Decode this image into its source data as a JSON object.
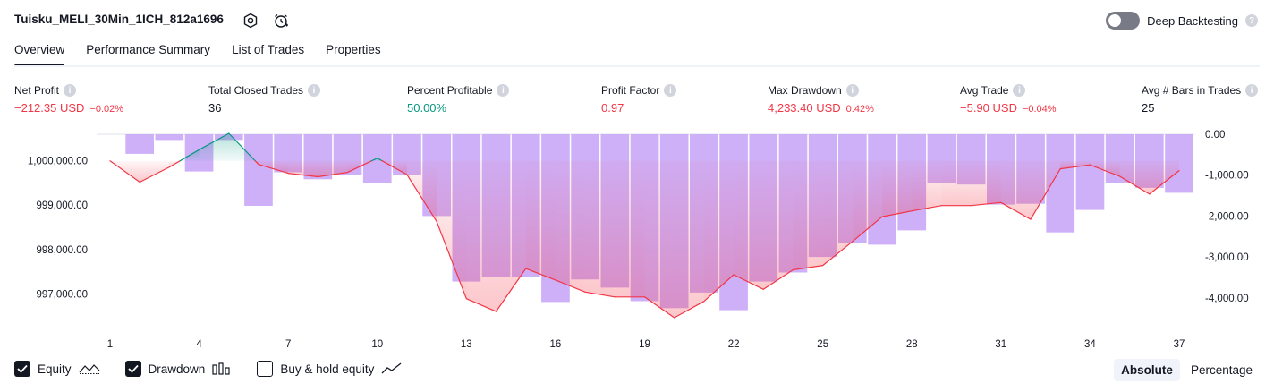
{
  "header": {
    "strategy_title": "Tuisku_MELI_30Min_1ICH_812a1696",
    "settings_icon": "settings-icon",
    "alert_icon": "alarm-clock-icon",
    "deep_backtesting_label": "Deep Backtesting",
    "deep_backtesting_on": false
  },
  "tabs": [
    {
      "label": "Overview",
      "active": true
    },
    {
      "label": "Performance Summary",
      "active": false
    },
    {
      "label": "List of Trades",
      "active": false
    },
    {
      "label": "Properties",
      "active": false
    }
  ],
  "metrics": {
    "net_profit": {
      "label": "Net Profit",
      "value": "−212.35 USD",
      "pct": "−0.02%"
    },
    "total_closed_trades": {
      "label": "Total Closed Trades",
      "value": "36"
    },
    "percent_profitable": {
      "label": "Percent Profitable",
      "value": "50.00%"
    },
    "profit_factor": {
      "label": "Profit Factor",
      "value": "0.97"
    },
    "max_drawdown": {
      "label": "Max Drawdown",
      "value": "4,233.40 USD",
      "pct": "0.42%"
    },
    "avg_trade": {
      "label": "Avg Trade",
      "value": "−5.90 USD",
      "pct": "−0.04%"
    },
    "avg_bars": {
      "label": "Avg # Bars in Trades",
      "value": "25"
    }
  },
  "legend": {
    "equity_label": "Equity",
    "equity_checked": true,
    "drawdown_label": "Drawdown",
    "drawdown_checked": true,
    "buyhold_label": "Buy & hold equity",
    "buyhold_checked": false
  },
  "view_toggle": {
    "absolute_label": "Absolute",
    "percentage_label": "Percentage",
    "active": "Absolute"
  },
  "colors": {
    "accent": "#131722",
    "negative": "#f23645",
    "positive": "#089981",
    "drawdown_bar": "#c9a7f7",
    "equity_line": "#f23645"
  },
  "chart_data": {
    "type": "line",
    "x_ticks": [
      "1",
      "4",
      "7",
      "10",
      "13",
      "16",
      "19",
      "22",
      "25",
      "28",
      "31",
      "34",
      "37"
    ],
    "left_axis": {
      "ticks": [
        "1,000,000.00",
        "999,000.00",
        "998,000.00",
        "997,000.00"
      ],
      "tick_values": [
        1000000,
        999000,
        998000,
        997000
      ],
      "ylim": [
        996400,
        1000600
      ]
    },
    "right_axis": {
      "ticks": [
        "0.00",
        "-1,000.00",
        "-2,000.00",
        "-3,000.00",
        "-4,000.00"
      ],
      "tick_values": [
        0,
        -1000,
        -2000,
        -3000,
        -4000
      ],
      "ylim": [
        -4550,
        0
      ]
    },
    "baseline_equity": 1000000,
    "x": [
      1,
      2,
      3,
      4,
      5,
      6,
      7,
      8,
      9,
      10,
      11,
      12,
      13,
      14,
      15,
      16,
      17,
      18,
      19,
      20,
      21,
      22,
      23,
      24,
      25,
      26,
      27,
      28,
      29,
      30,
      31,
      32,
      33,
      34,
      35,
      36,
      37
    ],
    "series": [
      {
        "name": "Equity",
        "type": "line",
        "values": [
          1000000,
          999520,
          999860,
          1000250,
          1000620,
          999920,
          999720,
          999640,
          999740,
          1000060,
          999690,
          998630,
          996890,
          996600,
          997570,
          997310,
          997040,
          996930,
          996930,
          996460,
          996830,
          997430,
          997100,
          997540,
          997640,
          998180,
          998740,
          998870,
          998990,
          998990,
          999060,
          998680,
          999820,
          999910,
          999650,
          999250,
          999780
        ]
      },
      {
        "name": "Drawdown",
        "type": "bar",
        "values": [
          0,
          -480,
          -140,
          -910,
          -140,
          -1750,
          -930,
          -1100,
          -1000,
          -1200,
          -1000,
          -2000,
          -3600,
          -3500,
          -3500,
          -4100,
          -3550,
          -3750,
          -4080,
          -4250,
          -3870,
          -4300,
          -3600,
          -3380,
          -3000,
          -2650,
          -2700,
          -2350,
          -1200,
          -1230,
          -1720,
          -1700,
          -2400,
          -1850,
          -1200,
          -1310,
          -1430
        ]
      }
    ]
  }
}
